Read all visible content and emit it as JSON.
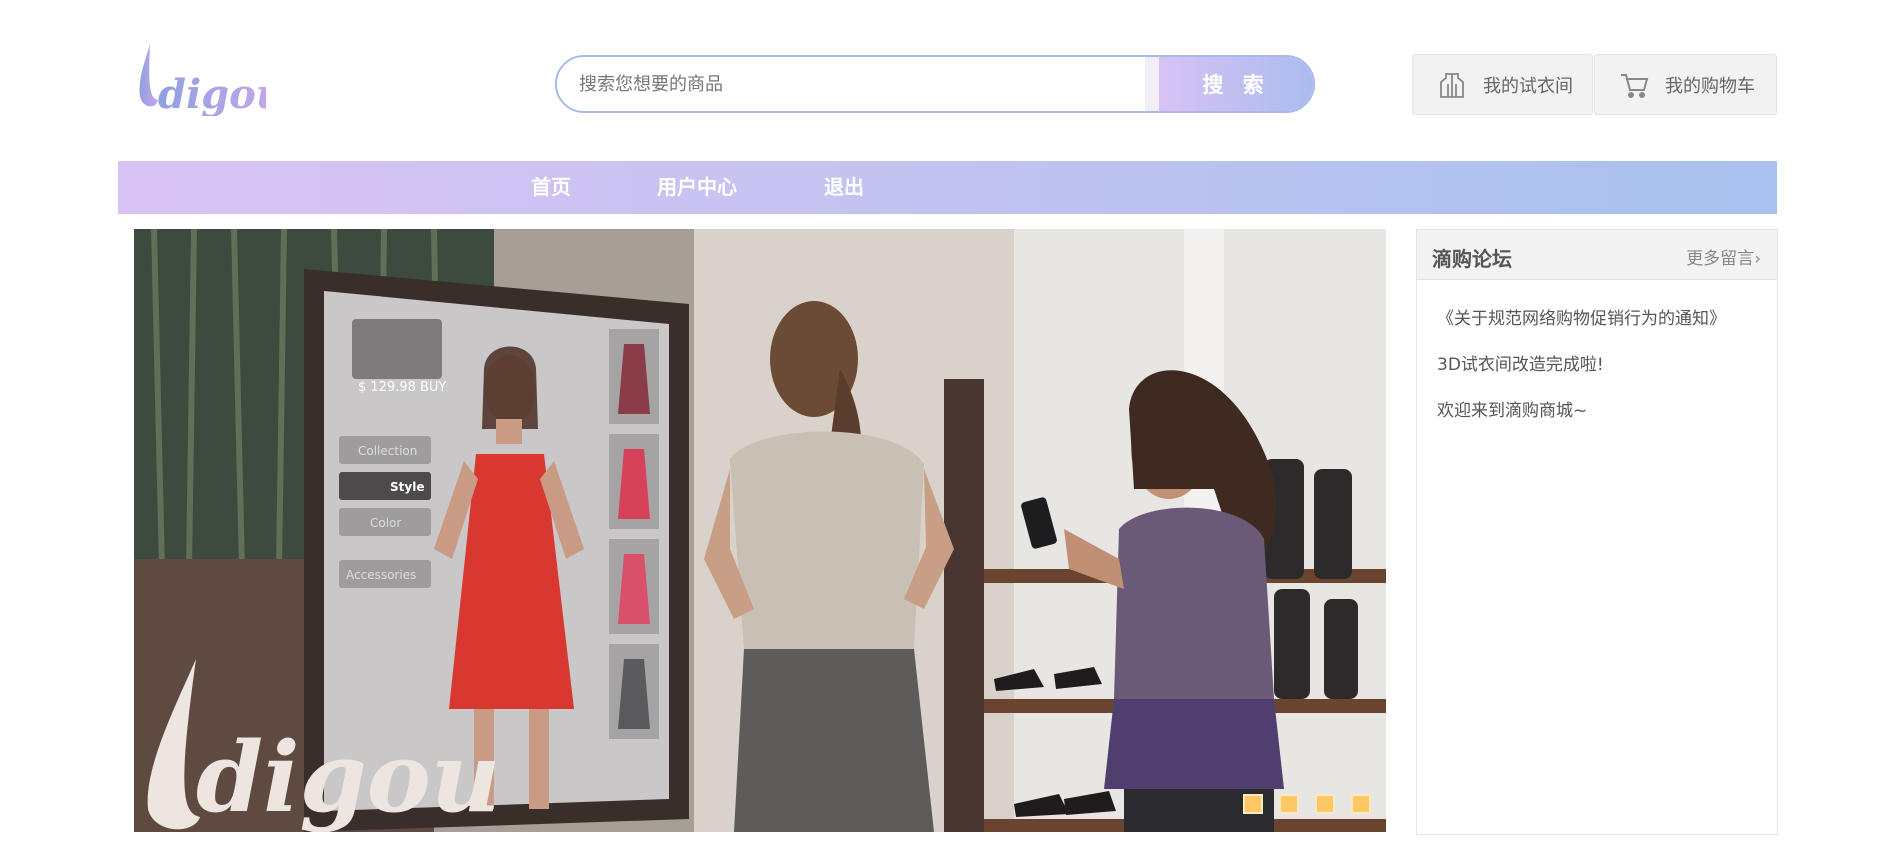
{
  "header": {
    "logo_text": "digou",
    "search": {
      "placeholder": "搜索您想要的商品",
      "button_label": "搜 索"
    },
    "fitting_room": {
      "label": "我的试衣间",
      "icon": "hanger-icon"
    },
    "cart": {
      "label": "我的购物车",
      "icon": "cart-icon"
    }
  },
  "nav": {
    "items": [
      {
        "label": "首页"
      },
      {
        "label": "用户中心"
      },
      {
        "label": "退出"
      }
    ]
  },
  "banner": {
    "logo_text": "digou",
    "mirror_price": "$ 129.98",
    "mirror_buy": "BUY",
    "mirror_menu": [
      "Collection",
      "Style",
      "Color",
      "Accessories"
    ],
    "slide_count": 4
  },
  "forum": {
    "title": "滴购论坛",
    "more_label": "更多留言",
    "posts": [
      {
        "title": "《关于规范网络购物促销行为的通知》"
      },
      {
        "title": "3D试衣间改造完成啦!"
      },
      {
        "title": "欢迎来到滴购商城~"
      }
    ]
  },
  "colors": {
    "brand_gradient_start": "#d9c3f4",
    "brand_gradient_end": "#a8c1ee",
    "carousel_dot": "#ffc864"
  }
}
